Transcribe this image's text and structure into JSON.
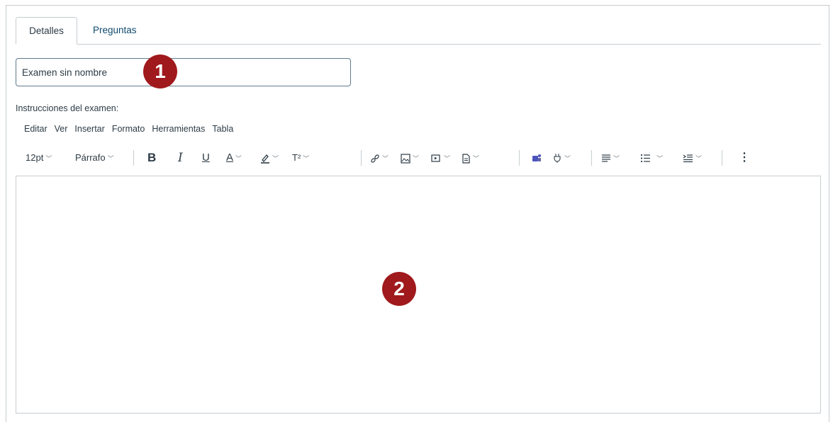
{
  "tabs": [
    {
      "label": "Detalles",
      "active": true
    },
    {
      "label": "Preguntas",
      "active": false
    }
  ],
  "title_input": {
    "value": "Examen sin nombre"
  },
  "instructions_label": "Instrucciones del examen:",
  "menubar": [
    "Editar",
    "Ver",
    "Insertar",
    "Formato",
    "Herramientas",
    "Tabla"
  ],
  "toolbar": {
    "font_size": "12pt",
    "block_format": "Párrafo",
    "bold": "B",
    "italic": "I",
    "underline": "U",
    "text_color": "A",
    "superscript": "T²",
    "more": "⋮"
  },
  "badges": [
    "1",
    "2"
  ],
  "colors": {
    "accent_link": "#0e4a6e",
    "border": "#c7cdd1",
    "badge": "#a0191c",
    "teams": "#4b53bc"
  },
  "icons": [
    "link-icon",
    "image-icon",
    "media-icon",
    "document-icon",
    "teams-icon",
    "apps-icon",
    "align-icon",
    "bullet-list-icon",
    "indent-icon"
  ]
}
